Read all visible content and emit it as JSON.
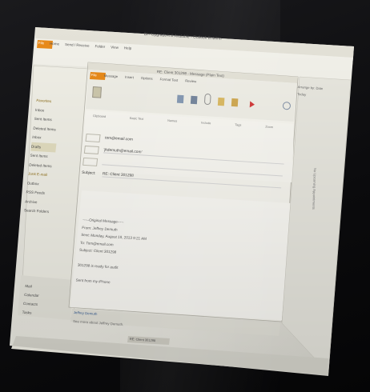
{
  "photo": {
    "subject": "computer monitor showing Outlook reply window",
    "screen_bg": "#ecebe3",
    "accent": "#e88a1a",
    "folder_accent": "#c69a2c"
  },
  "outlook": {
    "main_title": "Di - Upgrade4n9 Avalable - Outlook Enteinn",
    "menu_tabs": [
      "File",
      "Home",
      "Send / Receive",
      "Folder",
      "View",
      "Help"
    ],
    "folder_tree": [
      "Favorites",
      "Inbox",
      "Sent Items",
      "Deleted Items",
      "",
      "Inbox",
      "Drafts",
      "Sent Items",
      "Deleted Items",
      "Junk E-mail",
      "Outbox",
      "RSS Feeds",
      "Archive",
      "Search Folders"
    ],
    "nav": [
      "Mail",
      "Calendar",
      "Contacts",
      "Tasks"
    ],
    "compose": {
      "title": "RE: Client 301298 - Message (Plain Text)",
      "ribbon_tabs": [
        "File",
        "Message",
        "Insert",
        "Options",
        "Format Text",
        "Review"
      ],
      "ribbon_groups": [
        "Clipboard",
        "Basic Text",
        "Names",
        "Include",
        "Tags",
        "Zoom"
      ],
      "from": "tom@email.com",
      "to": "'jkdemuth@email.com'",
      "cc": "",
      "subject_label": "Subject:",
      "subject": "RE: Client 301298",
      "body_lines": [
        "-----Original Message-----",
        "From: Jeffrey Demuth",
        "Sent: Monday, August 19, 2013 9:21 AM",
        "To: Tom@email.com",
        "Subject: Client 301298",
        "",
        "301298 is ready for audit",
        "",
        "Sent from my iPhone"
      ],
      "reply_name": "Jeffrey Demuth",
      "people_pane": "See more about Jeffrey Demuth."
    },
    "right_pane": [
      "Arrange by: Date",
      "Today",
      "No Upcoming Appointments"
    ],
    "taskbar_item": "RE: Client 301298"
  }
}
